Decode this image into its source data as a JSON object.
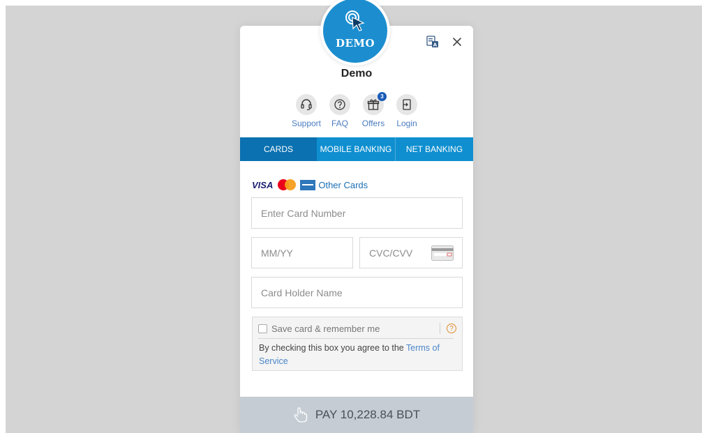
{
  "merchant": {
    "logo_text": "DEMO",
    "name": "Demo"
  },
  "header_icons": {
    "translate": "translate-icon",
    "close": "close-icon"
  },
  "quick_links": [
    {
      "label": "Support",
      "icon": "headset-icon"
    },
    {
      "label": "FAQ",
      "icon": "question-icon"
    },
    {
      "label": "Offers",
      "icon": "gift-icon",
      "badge": "3"
    },
    {
      "label": "Login",
      "icon": "login-icon"
    }
  ],
  "tabs": [
    {
      "label": "CARDS",
      "active": true
    },
    {
      "label": "MOBILE BANKING",
      "active": false
    },
    {
      "label": "NET BANKING",
      "active": false
    }
  ],
  "card_brands": {
    "visa": "VISA",
    "other_cards": "Other Cards"
  },
  "fields": {
    "card_number": {
      "placeholder": "Enter Card Number",
      "value": ""
    },
    "expiry": {
      "placeholder": "MM/YY",
      "value": ""
    },
    "cvc": {
      "placeholder": "CVC/CVV",
      "value": ""
    },
    "holder_name": {
      "placeholder": "Card Holder Name",
      "value": ""
    }
  },
  "save_card": {
    "label": "Save card & remember me",
    "checked": false,
    "help": "?",
    "agree_text": "By checking this box you agree to the ",
    "terms_link": "Terms of Service"
  },
  "pay_button": {
    "label": "PAY 10,228.84 BDT"
  },
  "colors": {
    "primary": "#0f8fd0",
    "active_tab": "#0b71b0",
    "pay_disabled": "#c5ccd4",
    "link": "#4a86c8"
  }
}
